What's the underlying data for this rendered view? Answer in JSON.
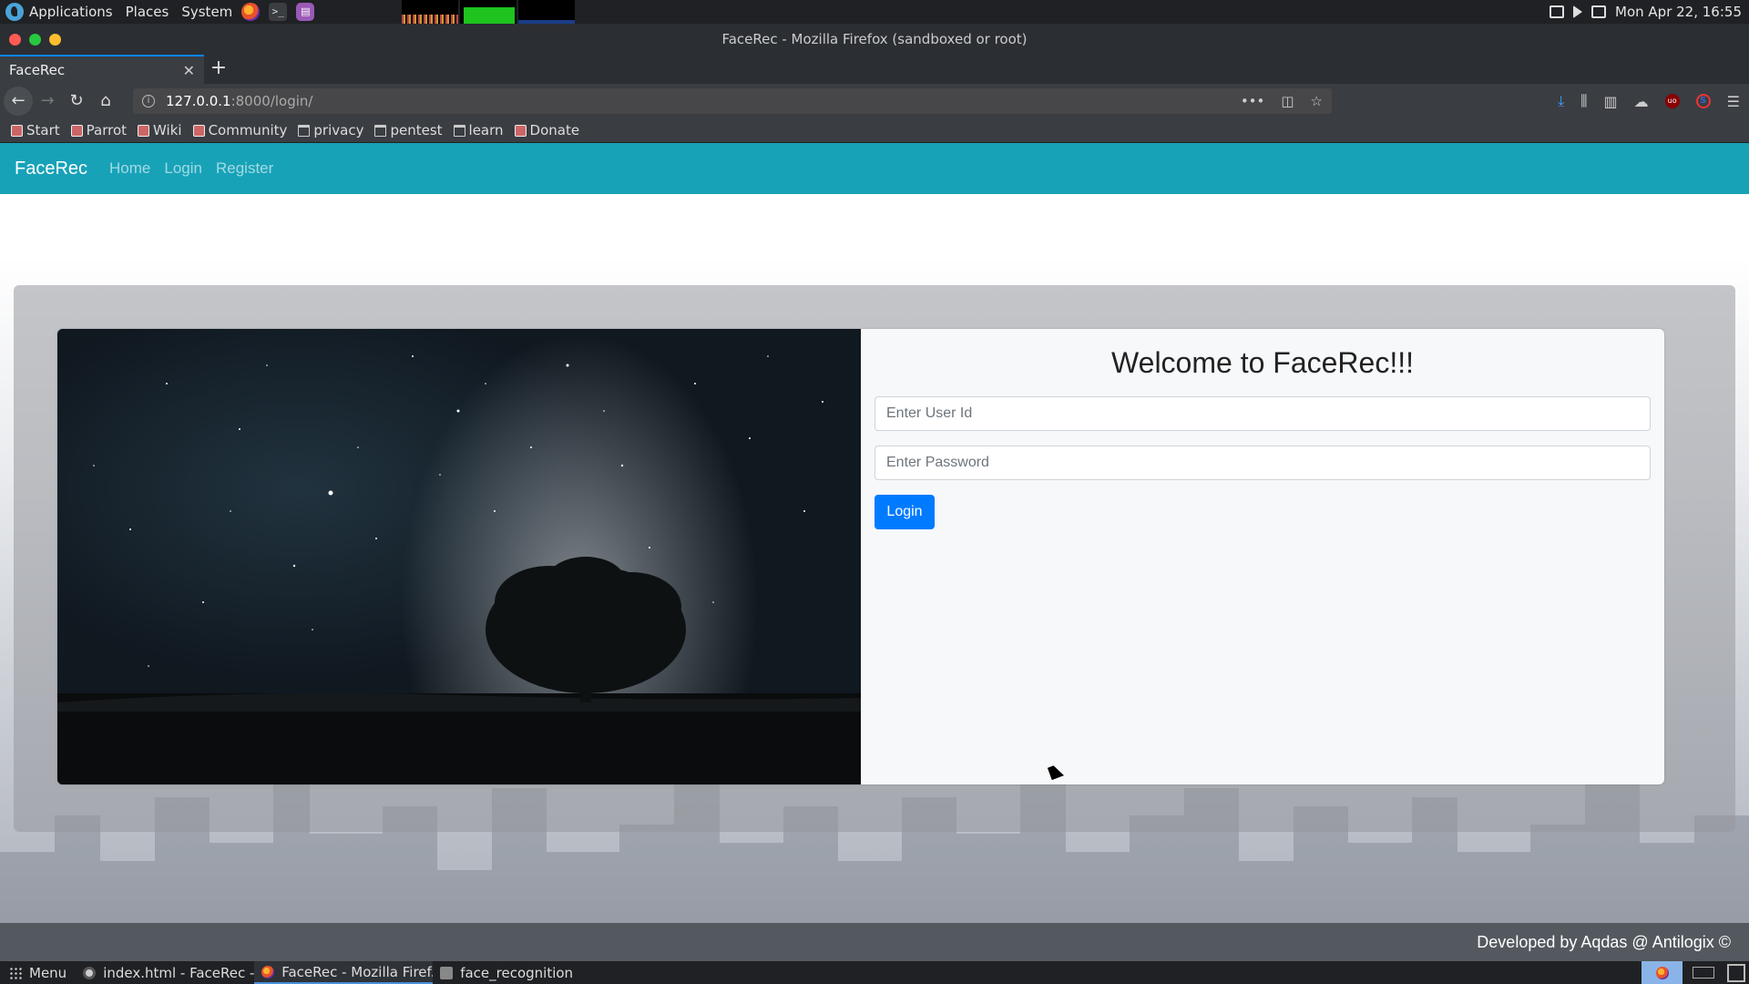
{
  "system_panel": {
    "menus": [
      "Applications",
      "Places",
      "System"
    ],
    "clock": "Mon Apr 22, 16:55"
  },
  "window": {
    "title": "FaceRec - Mozilla Firefox (sandboxed or root)"
  },
  "tabs": [
    {
      "label": "FaceRec"
    }
  ],
  "urlbar": {
    "host": "127.0.0.1",
    "path": ":8000/login/"
  },
  "bookmarks": [
    {
      "label": "Start",
      "icon": "page-icon"
    },
    {
      "label": "Parrot",
      "icon": "page-icon"
    },
    {
      "label": "Wiki",
      "icon": "page-icon"
    },
    {
      "label": "Community",
      "icon": "page-icon"
    },
    {
      "label": "privacy",
      "icon": "folder-icon"
    },
    {
      "label": "pentest",
      "icon": "folder-icon"
    },
    {
      "label": "learn",
      "icon": "folder-icon"
    },
    {
      "label": "Donate",
      "icon": "page-icon"
    }
  ],
  "site": {
    "brand": "FaceRec",
    "nav": [
      "Home",
      "Login",
      "Register"
    ],
    "welcome": "Welcome to FaceRec!!!",
    "userid_placeholder": "Enter User Id",
    "password_placeholder": "Enter Password",
    "login_button": "Login",
    "footer": "Developed by Aqdas @ Antilogix ©",
    "nav_color": "#17a2b8",
    "button_color": "#007bff"
  },
  "taskbar": {
    "menu": "Menu",
    "items": [
      {
        "label": "index.html - FaceRec - ...",
        "icon": "chrome-icon"
      },
      {
        "label": "FaceRec - Mozilla Firef...",
        "icon": "firefox-icon",
        "active": true
      },
      {
        "label": "face_recognition",
        "icon": "folder-icon"
      }
    ]
  }
}
